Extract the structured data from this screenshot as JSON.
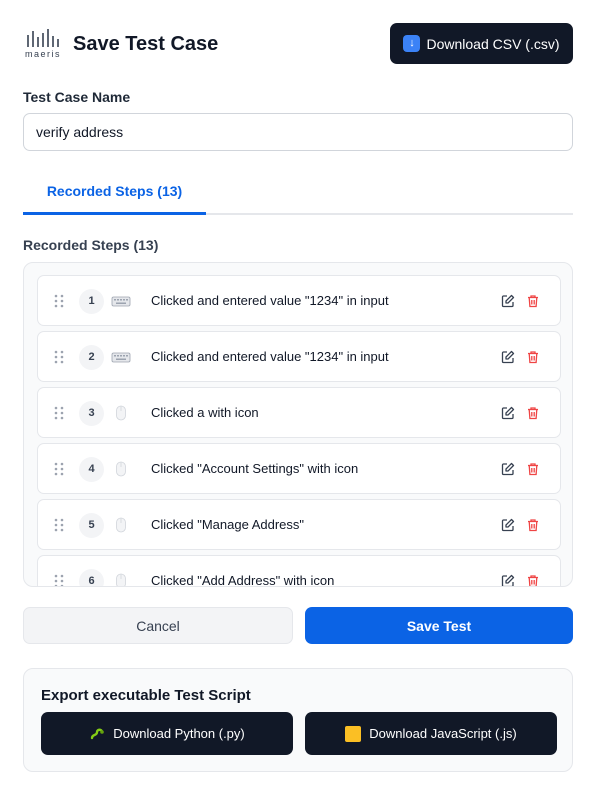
{
  "header": {
    "logo_text": "maeris",
    "title": "Save Test Case",
    "download_csv_label": "Download CSV (.csv)",
    "download_csv_icon": "down-arrow-emoji-icon"
  },
  "form": {
    "name_label": "Test Case Name",
    "name_value": "verify address"
  },
  "tabs": [
    {
      "label": "Recorded Steps (13)",
      "active": true
    }
  ],
  "steps_section": {
    "title": "Recorded Steps (13)",
    "steps": [
      {
        "number": "1",
        "kind": "keyboard-icon",
        "text": "Clicked and entered value \"1234\" in input"
      },
      {
        "number": "2",
        "kind": "keyboard-icon",
        "text": "Clicked and entered value \"1234\" in input"
      },
      {
        "number": "3",
        "kind": "mouse-icon",
        "text": "Clicked a with icon"
      },
      {
        "number": "4",
        "kind": "mouse-icon",
        "text": "Clicked \"Account Settings\" with icon"
      },
      {
        "number": "5",
        "kind": "mouse-icon",
        "text": "Clicked \"Manage Address\""
      },
      {
        "number": "6",
        "kind": "mouse-icon",
        "text": "Clicked \"Add Address\" with icon"
      }
    ]
  },
  "actions": {
    "cancel_label": "Cancel",
    "save_label": "Save Test"
  },
  "export": {
    "title": "Export executable Test Script",
    "python_label": "Download Python (.py)",
    "javascript_label": "Download JavaScript (.js)"
  },
  "colors": {
    "accent": "#0b63e5",
    "dark_button": "#111827",
    "delete_icon": "#ef4444"
  }
}
